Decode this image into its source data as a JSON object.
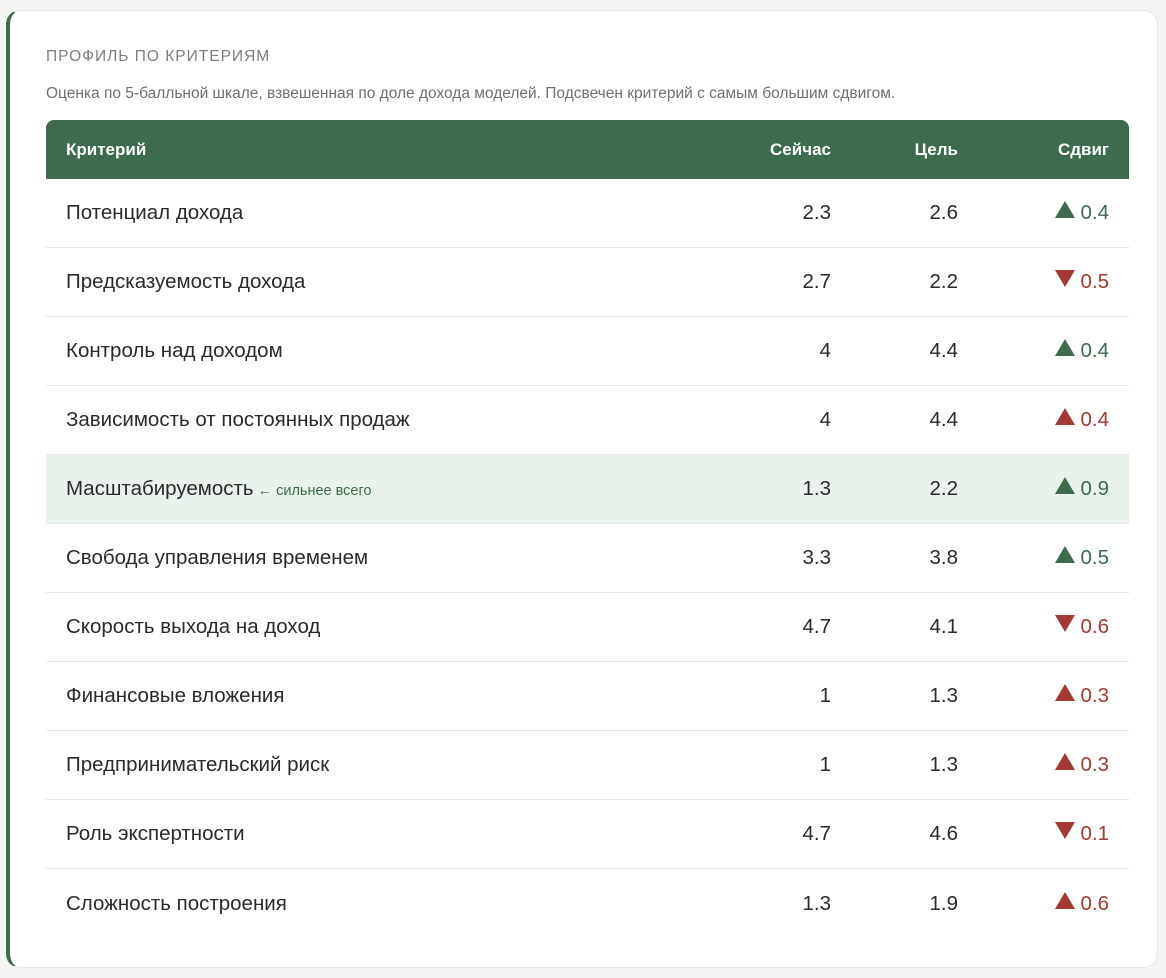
{
  "card": {
    "title": "Профиль по критериям",
    "subtitle": "Оценка по 5-балльной шкале, взвешенная по доле дохода моделей. Подсвечен критерий с самым большим сдвигом."
  },
  "table": {
    "headers": {
      "criterion": "Критерий",
      "now": "Сейчас",
      "goal": "Цель",
      "shift": "Сдвиг"
    },
    "colors": {
      "good": "#3e6b4e",
      "bad": "#a33a34",
      "header_bg": "#3e6b4e",
      "highlight_bg": "#eaf2ec"
    },
    "rows": [
      {
        "name": "Потенциал дохода",
        "hint": "",
        "now": "2.3",
        "goal": "2.6",
        "shift": "0.4",
        "direction": "up",
        "tone": "good",
        "highlight": false
      },
      {
        "name": "Предсказуемость дохода",
        "hint": "",
        "now": "2.7",
        "goal": "2.2",
        "shift": "0.5",
        "direction": "down",
        "tone": "bad",
        "highlight": false
      },
      {
        "name": "Контроль над доходом",
        "hint": "",
        "now": "4",
        "goal": "4.4",
        "shift": "0.4",
        "direction": "up",
        "tone": "good",
        "highlight": false
      },
      {
        "name": "Зависимость от постоянных продаж",
        "hint": "",
        "now": "4",
        "goal": "4.4",
        "shift": "0.4",
        "direction": "up",
        "tone": "bad",
        "highlight": false
      },
      {
        "name": "Масштабируемость",
        "hint": "← сильнее всего",
        "now": "1.3",
        "goal": "2.2",
        "shift": "0.9",
        "direction": "up",
        "tone": "good",
        "highlight": true
      },
      {
        "name": "Свобода управления временем",
        "hint": "",
        "now": "3.3",
        "goal": "3.8",
        "shift": "0.5",
        "direction": "up",
        "tone": "good",
        "highlight": false
      },
      {
        "name": "Скорость выхода на доход",
        "hint": "",
        "now": "4.7",
        "goal": "4.1",
        "shift": "0.6",
        "direction": "down",
        "tone": "bad",
        "highlight": false
      },
      {
        "name": "Финансовые вложения",
        "hint": "",
        "now": "1",
        "goal": "1.3",
        "shift": "0.3",
        "direction": "up",
        "tone": "bad",
        "highlight": false
      },
      {
        "name": "Предпринимательский риск",
        "hint": "",
        "now": "1",
        "goal": "1.3",
        "shift": "0.3",
        "direction": "up",
        "tone": "bad",
        "highlight": false
      },
      {
        "name": "Роль экспертности",
        "hint": "",
        "now": "4.7",
        "goal": "4.6",
        "shift": "0.1",
        "direction": "down",
        "tone": "bad",
        "highlight": false
      },
      {
        "name": "Сложность построения",
        "hint": "",
        "now": "1.3",
        "goal": "1.9",
        "shift": "0.6",
        "direction": "up",
        "tone": "bad",
        "highlight": false
      }
    ]
  }
}
